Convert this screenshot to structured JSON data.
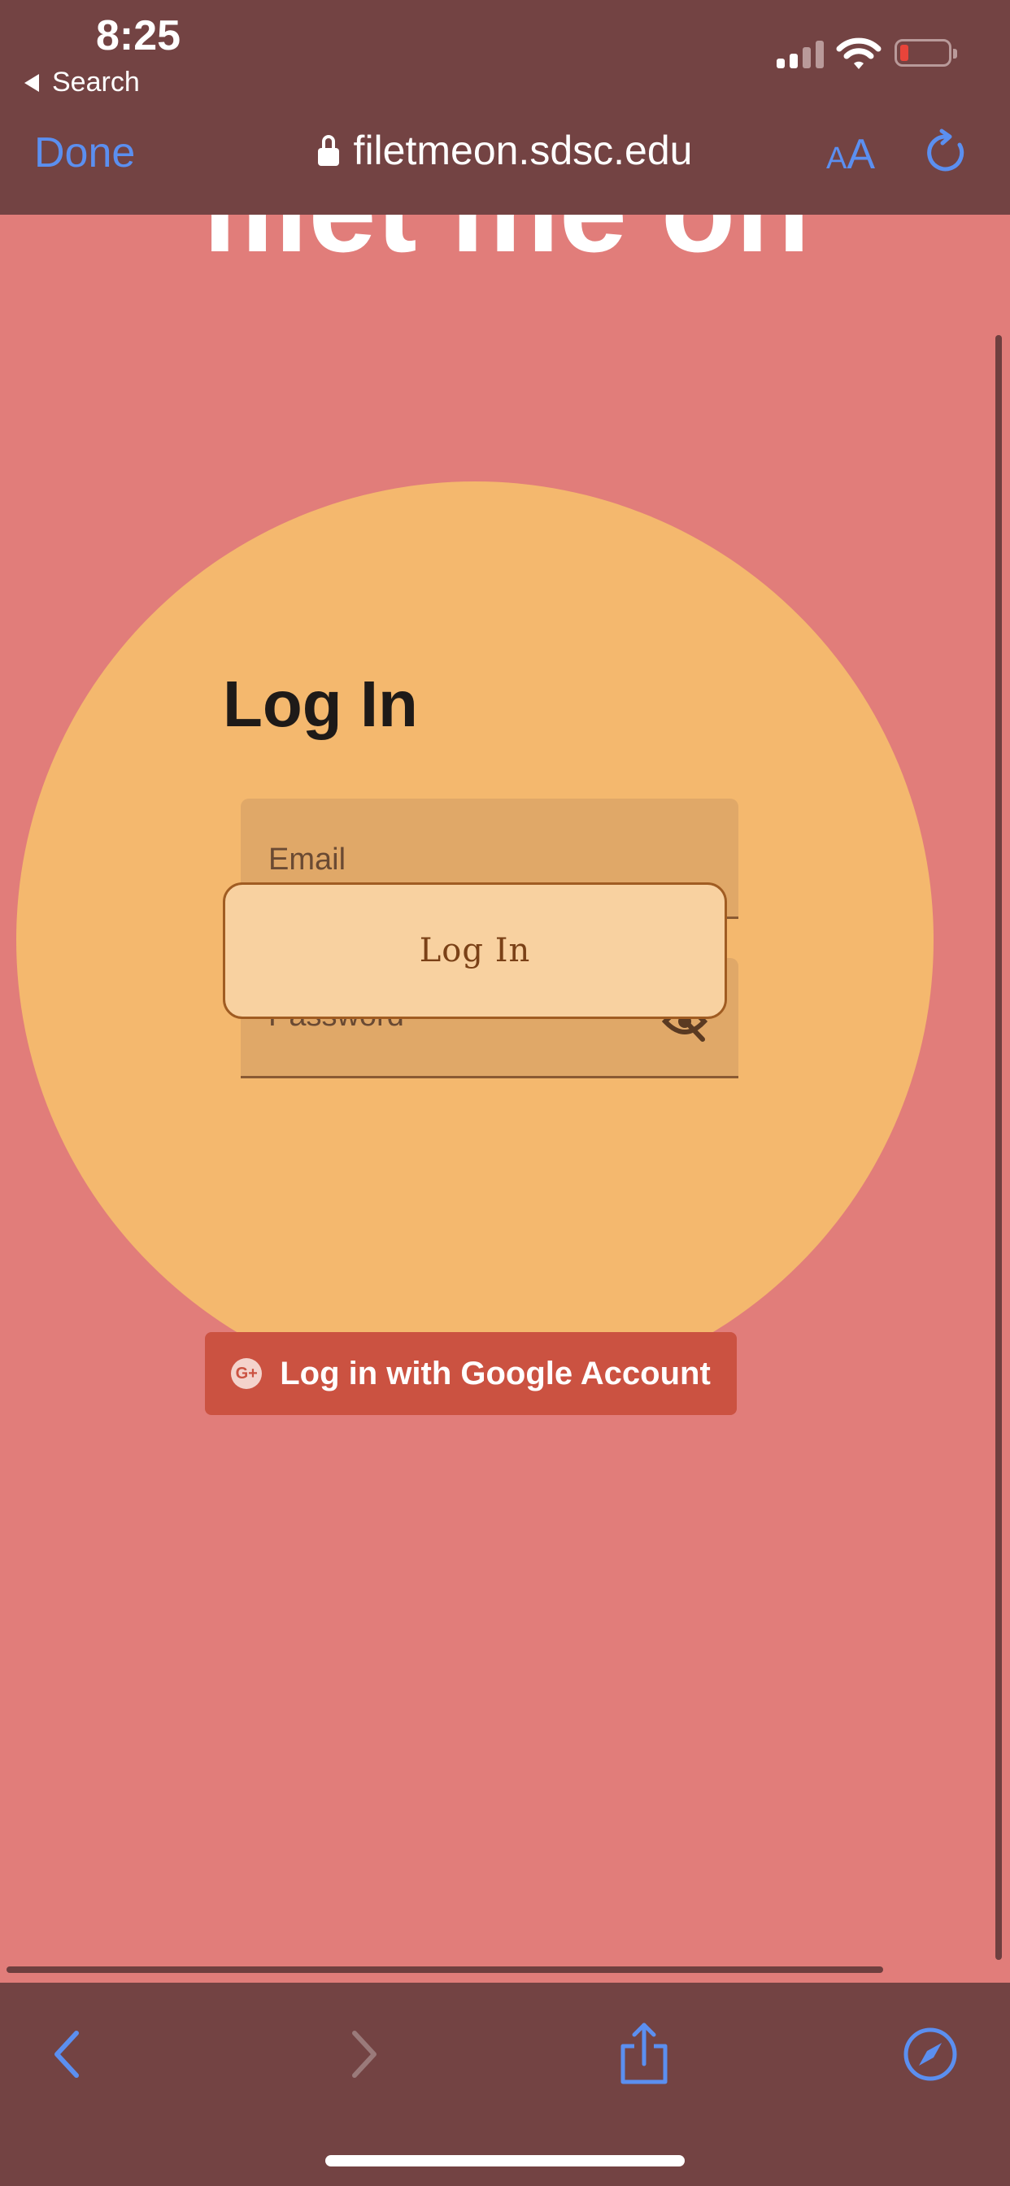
{
  "status_bar": {
    "time": "8:25",
    "back_app": "Search"
  },
  "safari_header": {
    "done_label": "Done",
    "url": "filetmeon.sdsc.edu",
    "aa_small": "A",
    "aa_big": "A"
  },
  "page": {
    "cut_title": "filet me on",
    "login": {
      "title": "Log In",
      "email_placeholder": "Email",
      "password_placeholder": "Password",
      "popover_label": "Log In"
    },
    "google_button": {
      "icon_text": "G+",
      "label": "Log in with Google Account"
    }
  },
  "colors": {
    "page_bg": "#e17d7a",
    "bars_bg": "#734343",
    "circle": "#f4b86e",
    "field_bg": "#e0a868",
    "popover_bg": "#f8d1a0",
    "google_red": "#cb5241",
    "ios_blue": "#5b8ff0"
  },
  "icons": {
    "back": "chevron-left-icon",
    "forward": "chevron-right-icon",
    "share": "share-icon",
    "compass": "compass-icon",
    "reload": "reload-icon",
    "lock": "lock-icon",
    "eye": "eye-slash-icon"
  }
}
